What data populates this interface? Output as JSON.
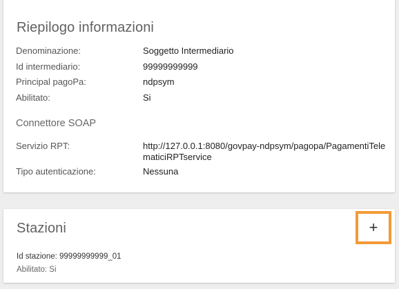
{
  "riepilogo": {
    "title": "Riepilogo informazioni",
    "rows": [
      {
        "label": "Denominazione:",
        "value": "Soggetto Intermediario"
      },
      {
        "label": "Id intermediario:",
        "value": "99999999999"
      },
      {
        "label": "Principal pagoPa:",
        "value": "ndpsym"
      },
      {
        "label": "Abilitato:",
        "value": "Si"
      }
    ],
    "connettore": {
      "title": "Connettore SOAP",
      "rows": [
        {
          "label": "Servizio RPT:",
          "value": "http://127.0.0.1:8080/govpay-ndpsym/pagopa/PagamentiTelematiciRPTservice"
        },
        {
          "label": "Tipo autenticazione:",
          "value": "Nessuna"
        }
      ]
    }
  },
  "stazioni": {
    "title": "Stazioni",
    "add_label": "+",
    "items": [
      {
        "id_text": "Id stazione: 99999999999_01",
        "enabled_text": "Abilitato: Si"
      }
    ]
  },
  "colors": {
    "highlight_border": "#f39a38",
    "card_background": "#ffffff",
    "page_background": "#eeeeee"
  },
  "icons": {
    "add": "plus-icon"
  }
}
